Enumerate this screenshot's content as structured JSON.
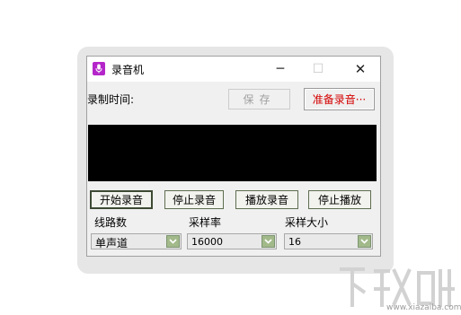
{
  "window": {
    "title": "录音机",
    "controls": {
      "minimize": "─",
      "maximize": "☐",
      "close": "✕"
    }
  },
  "top": {
    "record_time_label": "录制时间:",
    "save_label": "保存",
    "status_label": "准备录音···"
  },
  "buttons": {
    "start_record": "开始录音",
    "stop_record": "停止录音",
    "play_record": "播放录音",
    "stop_play": "停止播放"
  },
  "settings": {
    "line": {
      "label": "线路数",
      "value": "单声道"
    },
    "sample_rate": {
      "label": "采样率",
      "value": "16000"
    },
    "sample_size": {
      "label": "采样大小",
      "value": "16"
    }
  },
  "watermark": {
    "brand": "下载吧",
    "url": "www.xiazaiba.com"
  },
  "colors": {
    "accent_icon": "#b426c9",
    "status_text": "#d40000",
    "combo_arrow": "#a2b98a",
    "display": "#000000"
  },
  "icons": {
    "app": "microphone-icon",
    "dropdown": "chevron-down-icon"
  }
}
